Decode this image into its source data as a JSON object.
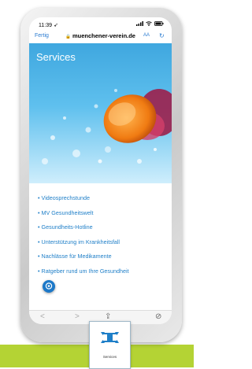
{
  "status_bar": {
    "time": "11:39",
    "location_symbol": "➶"
  },
  "browser": {
    "done_label": "Fertig",
    "lock_symbol": "🔒",
    "url": "muenchener-verein.de",
    "aa_label": "AA",
    "reload_symbol": "↻"
  },
  "page": {
    "title": "Services",
    "items": [
      "Videosprechstunde",
      "MV Gesundheitswelt",
      "Gesundheits-Hotline",
      "Unterstützung im Krankheitsfall",
      "Nachlässe für Medikamente",
      "Ratgeber rund um Ihre Gesundheit"
    ],
    "bullet": "•"
  },
  "toolbar": {
    "back_symbol": "<",
    "forward_symbol": ">",
    "share_symbol": "⇪",
    "compass_symbol": "⊘"
  },
  "tag": {
    "label": "Services",
    "icon": "mv-logo-icon"
  },
  "colors": {
    "link": "#1f7fc8",
    "accent_bar": "#b4d334",
    "hero_sky": "#3fa7df"
  }
}
